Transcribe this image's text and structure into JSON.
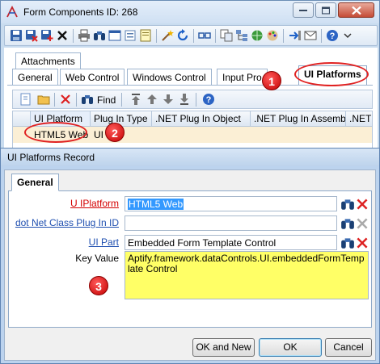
{
  "window": {
    "title": "Form Components ID: 268"
  },
  "tabs": {
    "attachments": "Attachments",
    "row": [
      "General",
      "Web Control",
      "Windows Control",
      "Input Pro",
      "UI Platforms"
    ]
  },
  "sub_toolbar": {
    "find_label": "Find"
  },
  "grid": {
    "columns": [
      "UI Platform",
      "Plug In Type",
      ".NET Plug In Object",
      ".NET Plug In Assembly",
      ".NET"
    ],
    "rows": [
      {
        "ui_platform": "HTML5 Web",
        "plug_in_type": "UI"
      }
    ]
  },
  "dialog": {
    "title": "UI Platforms Record",
    "tab": "General",
    "fields": {
      "ui_platform": {
        "label": "U IPlatform",
        "value": "HTML5 Web"
      },
      "dotnet_class": {
        "label": "dot Net Class Plug In ID",
        "value": ""
      },
      "ui_part": {
        "label": "UI Part",
        "value": "Embedded Form Template Control"
      },
      "key_value": {
        "label": "Key Value",
        "value": "Aptify.framework.dataControls.UI.embeddedFormTemplate Control"
      }
    },
    "buttons": {
      "ok_and_new": "OK and New",
      "ok": "OK",
      "cancel": "Cancel"
    }
  },
  "callouts": [
    "1",
    "2",
    "3"
  ],
  "colors": {
    "callout_red": "#e02222",
    "key_value_bg": "#ffff66",
    "link_blue": "#1f4fb0",
    "required_red": "#d40000",
    "selected_row": "#fbefd5"
  }
}
